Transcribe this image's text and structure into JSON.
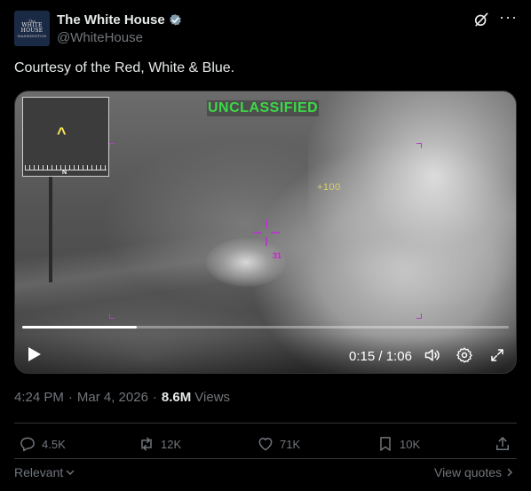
{
  "author": {
    "name": "The White House",
    "handle": "@WhiteHouse",
    "avatar_text": [
      "The",
      "WHITE",
      "HOUSE",
      "WASHINGTON"
    ],
    "verified_color": "#829aab"
  },
  "tweet": {
    "text": "Courtesy of the Red, White & Blue."
  },
  "video": {
    "overlay_label": "UNCLASSIFIED",
    "overlay_color": "#3bd946",
    "hud_readout": "+100",
    "hud_readout_2": "31",
    "compass_label": "N",
    "current_time": "0:15",
    "duration": "1:06",
    "time_separator": " / ",
    "progress": 0.235,
    "icons": [
      "play-icon",
      "volume-icon",
      "settings-icon",
      "fullscreen-icon"
    ]
  },
  "meta": {
    "time": "4:24 PM",
    "date": "Mar 4, 2026",
    "views_count": "8.6M",
    "views_label": "Views",
    "dot": "·"
  },
  "actions": {
    "replies": "4.5K",
    "reposts": "12K",
    "likes": "71K",
    "bookmarks": "10K"
  },
  "footer": {
    "sort_label": "Relevant",
    "view_quotes": "View quotes"
  }
}
